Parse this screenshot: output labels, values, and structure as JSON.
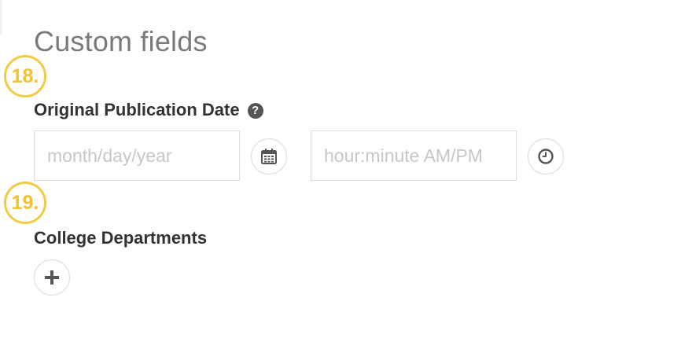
{
  "section": {
    "title": "Custom fields"
  },
  "steps": [
    {
      "label": "18."
    },
    {
      "label": "19."
    }
  ],
  "fields": {
    "publication_date": {
      "label": "Original Publication Date",
      "help_icon": "question-circle-icon",
      "date_placeholder": "month/day/year",
      "date_value": "",
      "calendar_icon": "calendar-icon",
      "time_placeholder": "hour:minute AM/PM",
      "time_value": "",
      "clock_icon": "clock-icon"
    },
    "departments": {
      "label": "College Departments",
      "add_icon": "plus-icon"
    }
  },
  "colors": {
    "badge": "#f1cb44",
    "label_text": "#333333",
    "title_text": "#7a7a7a",
    "placeholder": "#c7c7c7",
    "border": "#dcdcdc"
  }
}
